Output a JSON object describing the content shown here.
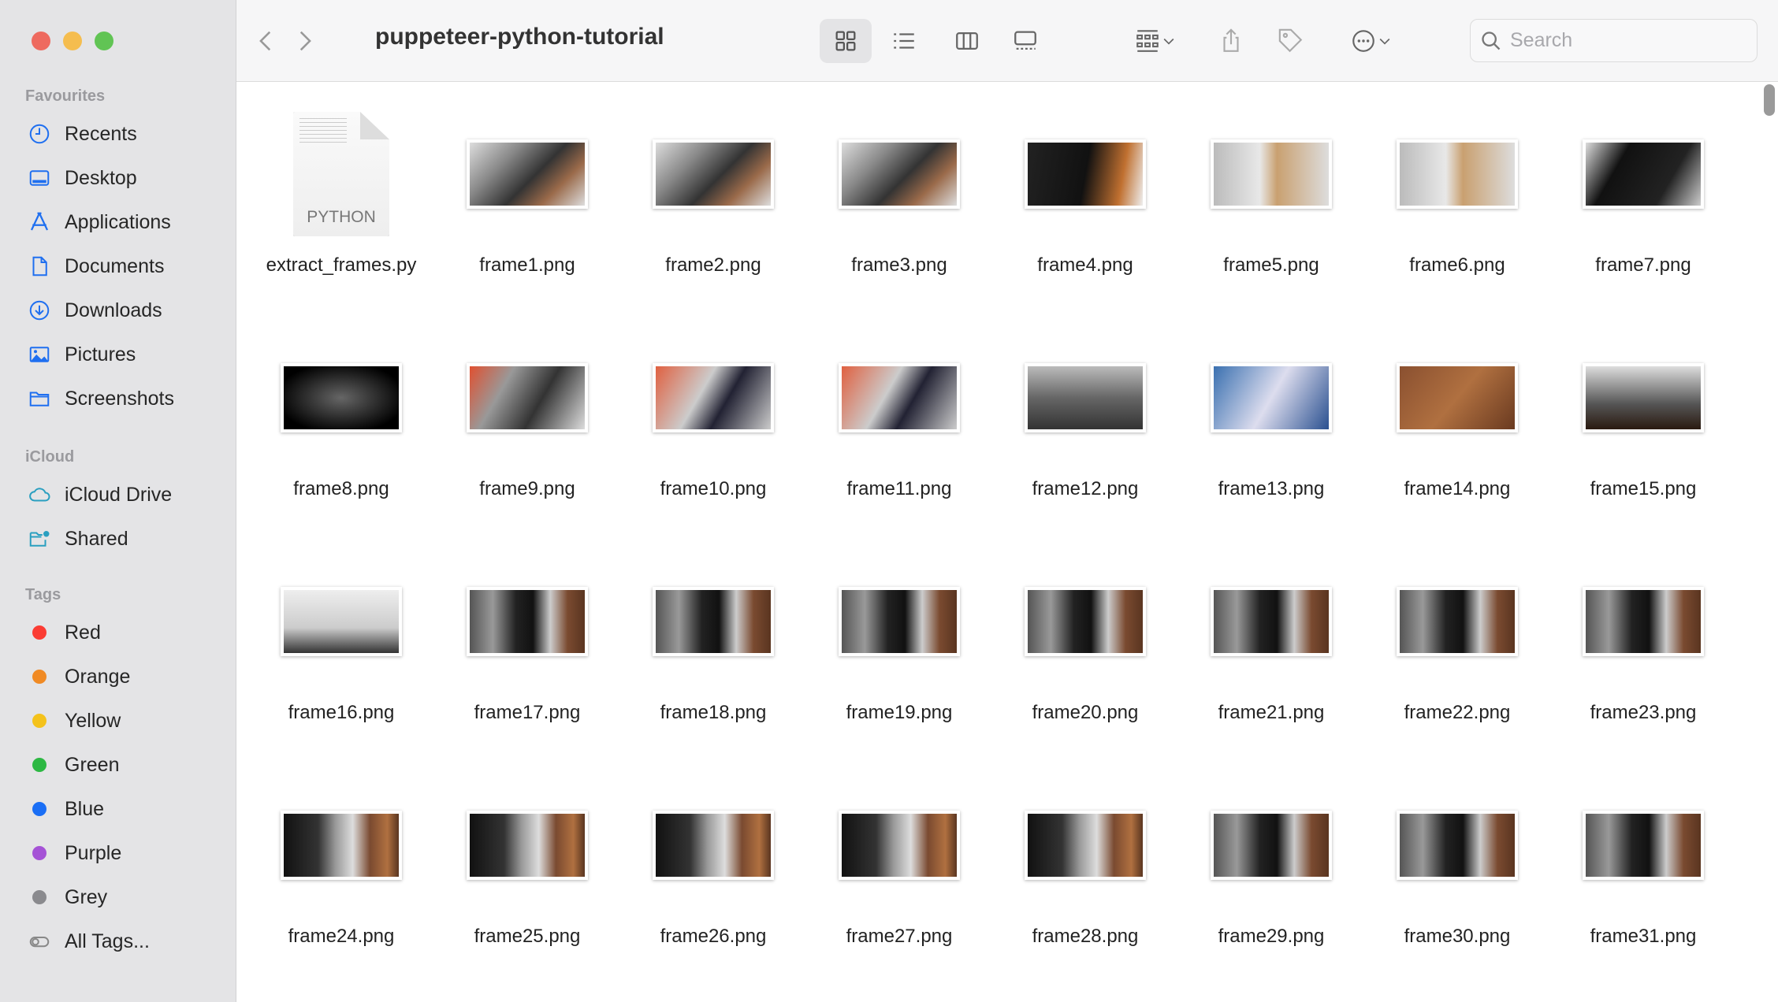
{
  "window": {
    "title": "puppeteer-python-tutorial",
    "traffic_lights": [
      "#ee6a5f",
      "#f5bd4f",
      "#61c454"
    ]
  },
  "toolbar": {
    "search_placeholder": "Search",
    "view_mode": "icon"
  },
  "sidebar": {
    "sections": [
      {
        "label": "Favourites",
        "items": [
          {
            "label": "Recents",
            "icon": "clock-icon"
          },
          {
            "label": "Desktop",
            "icon": "desktop-icon"
          },
          {
            "label": "Applications",
            "icon": "applications-icon"
          },
          {
            "label": "Documents",
            "icon": "document-icon"
          },
          {
            "label": "Downloads",
            "icon": "download-icon"
          },
          {
            "label": "Pictures",
            "icon": "pictures-icon"
          },
          {
            "label": "Screenshots",
            "icon": "folder-icon"
          }
        ]
      },
      {
        "label": "iCloud",
        "items": [
          {
            "label": "iCloud Drive",
            "icon": "cloud-icon"
          },
          {
            "label": "Shared",
            "icon": "shared-folder-icon"
          }
        ]
      },
      {
        "label": "Tags",
        "items": [
          {
            "label": "Red",
            "color": "#fb3c33"
          },
          {
            "label": "Orange",
            "color": "#f08a24"
          },
          {
            "label": "Yellow",
            "color": "#f4c21b"
          },
          {
            "label": "Green",
            "color": "#2db843"
          },
          {
            "label": "Blue",
            "color": "#1a6ef5"
          },
          {
            "label": "Purple",
            "color": "#a552d6"
          },
          {
            "label": "Grey",
            "color": "#8a8a8e"
          },
          {
            "label": "All Tags...",
            "icon": "all-tags-icon"
          }
        ]
      }
    ]
  },
  "files": [
    {
      "name": "extract_frames.py",
      "kind": "PYTHON"
    },
    {
      "name": "frame1.png"
    },
    {
      "name": "frame2.png"
    },
    {
      "name": "frame3.png"
    },
    {
      "name": "frame4.png"
    },
    {
      "name": "frame5.png"
    },
    {
      "name": "frame6.png"
    },
    {
      "name": "frame7.png"
    },
    {
      "name": "frame8.png"
    },
    {
      "name": "frame9.png"
    },
    {
      "name": "frame10.png"
    },
    {
      "name": "frame11.png"
    },
    {
      "name": "frame12.png"
    },
    {
      "name": "frame13.png"
    },
    {
      "name": "frame14.png"
    },
    {
      "name": "frame15.png"
    },
    {
      "name": "frame16.png"
    },
    {
      "name": "frame17.png"
    },
    {
      "name": "frame18.png"
    },
    {
      "name": "frame19.png"
    },
    {
      "name": "frame20.png"
    },
    {
      "name": "frame21.png"
    },
    {
      "name": "frame22.png"
    },
    {
      "name": "frame23.png"
    },
    {
      "name": "frame24.png"
    },
    {
      "name": "frame25.png"
    },
    {
      "name": "frame26.png"
    },
    {
      "name": "frame27.png"
    },
    {
      "name": "frame28.png"
    },
    {
      "name": "frame29.png"
    },
    {
      "name": "frame30.png"
    },
    {
      "name": "frame31.png"
    }
  ]
}
